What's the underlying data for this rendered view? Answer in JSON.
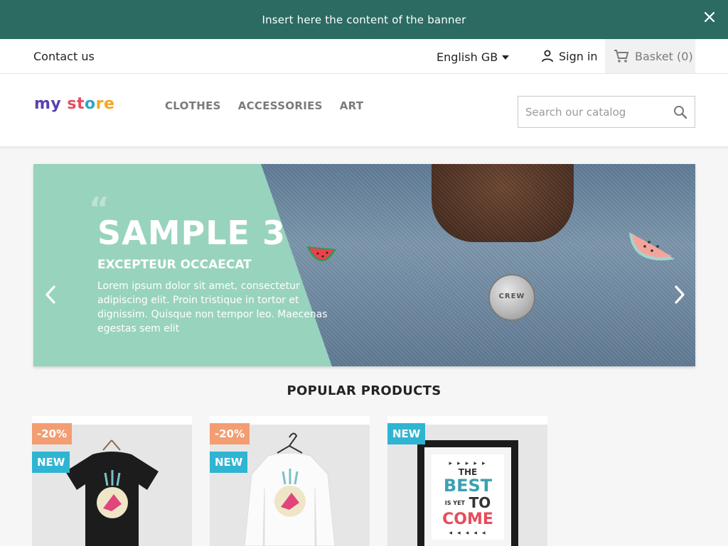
{
  "banner": {
    "text": "Insert here the content of the banner"
  },
  "nav": {
    "contact": "Contact us",
    "language": "English GB",
    "signin": "Sign in",
    "basket": "Basket (0)"
  },
  "header": {
    "logo_parts": [
      "my",
      " st",
      "o",
      "re"
    ],
    "menu": [
      "CLOTHES",
      "ACCESSORIES",
      "ART"
    ],
    "search_placeholder": "Search our catalog"
  },
  "carousel": {
    "quote_mark": "“",
    "title": "SAMPLE 3",
    "subtitle": "EXCEPTEUR OCCAECAT",
    "description": "Lorem ipsum dolor sit amet, consectetur adipiscing elit. Proin tristique in tortor et dignissim. Quisque non tempor leo. Maecenas egestas sem elit",
    "pin_text": "CREW"
  },
  "popular": {
    "title": "POPULAR PRODUCTS",
    "products": [
      {
        "discount": "-20%",
        "new": "NEW"
      },
      {
        "discount": "-20%",
        "new": "NEW"
      },
      {
        "new": "NEW"
      }
    ],
    "poster": {
      "arrows": "▸ ▸ ▸ ▸ ▸",
      "the": "THE",
      "best": "BEST",
      "is_yet": "IS YET",
      "to": "TO",
      "come": "COME",
      "arrows_bottom": "◂ ◂ ◂ ◂ ◂"
    }
  },
  "colors": {
    "banner_bg": "#2b6b62",
    "accent_green": "#98d3bd",
    "discount": "#f39d72",
    "new": "#2fb5d2"
  }
}
